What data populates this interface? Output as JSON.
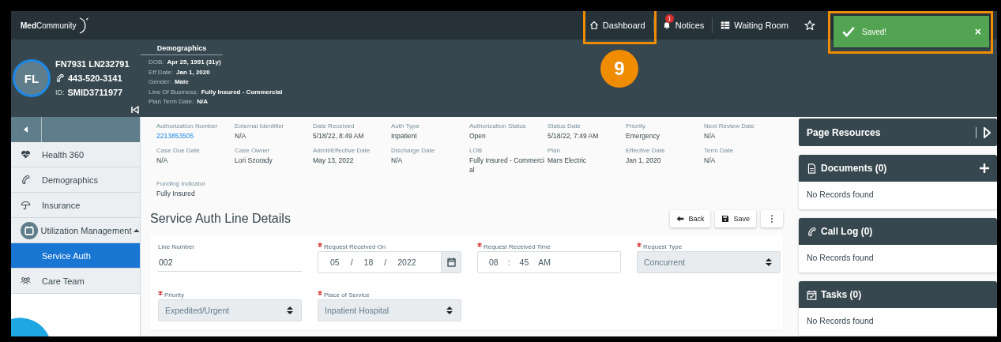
{
  "top_bar": {
    "logo": "**Med**Community",
    "nav": [
      {
        "kind": "dashboard",
        "label": "Dashboard"
      },
      {
        "kind": "notices",
        "label": "Notices",
        "badge": "1"
      },
      {
        "kind": "waiting",
        "label": "Waiting Room"
      },
      {
        "kind": "favorite"
      }
    ]
  },
  "toast": {
    "message": "Saved!",
    "close": "×"
  },
  "annotation": {
    "step": "9"
  },
  "patient": {
    "initials": "FL",
    "name": "FN7931 LN232791",
    "phone": "443-520-3141",
    "id_label": "ID:",
    "id": "SMID3711977"
  },
  "demographics": {
    "title": "Demographics",
    "rows": [
      {
        "label": "DOB:",
        "value": "Apr 25, 1991 (31y)"
      },
      {
        "label": "Eff Date:",
        "value": "Jan 1, 2020"
      },
      {
        "label": "Gender:",
        "value": "Male"
      },
      {
        "label": "Line Of Business:",
        "value": "Fully Insured - Commercial"
      },
      {
        "label": "Plan Term Date:",
        "value": "N/A"
      }
    ]
  },
  "sidebar": {
    "items": [
      {
        "kind": "heart",
        "label": "Health 360",
        "selected": false
      },
      {
        "kind": "phone",
        "label": "Demographics",
        "selected": false
      },
      {
        "kind": "umbrella",
        "label": "Insurance",
        "selected": false
      },
      {
        "kind": "calendar",
        "label": "Utilization Management",
        "selected": false,
        "expanded": true,
        "children": [
          {
            "label": "Service Auth",
            "selected": true
          }
        ]
      },
      {
        "kind": "team",
        "label": "Care Team",
        "selected": false
      }
    ]
  },
  "auth_info": [
    {
      "label": "Authorization Number",
      "value": "2213853505",
      "link": true
    },
    {
      "label": "External Identifier",
      "value": "N/A"
    },
    {
      "label": "Date Received",
      "value": "5/18/22, 8:49 AM"
    },
    {
      "label": "Auth Type",
      "value": "Inpatient"
    },
    {
      "label": "Authorization Status",
      "value": "Open"
    },
    {
      "label": "Status Date",
      "value": "5/18/22, 7:49 AM"
    },
    {
      "label": "Priority",
      "value": "Emergency"
    },
    {
      "label": "Next Review Date",
      "value": "N/A"
    },
    {
      "label": "Case Due Date",
      "value": "N/A"
    },
    {
      "label": "Case Owner",
      "value": "Lori Szorady"
    },
    {
      "label": "Admit/Effective Date",
      "value": "May 13, 2022"
    },
    {
      "label": "Discharge Date",
      "value": "N/A"
    },
    {
      "label": "LOB",
      "value": "Fully Insured - Commercial"
    },
    {
      "label": "Plan",
      "value": "Mars Electric"
    },
    {
      "label": "Effective Date",
      "value": "Jan 1, 2020"
    },
    {
      "label": "Term Date",
      "value": "N/A"
    },
    {
      "label": "Funding Indicator",
      "value": "Fully Insured"
    }
  ],
  "section": {
    "title": "Service Auth Line Details",
    "buttons": [
      {
        "kind": "back",
        "label": "Back"
      },
      {
        "kind": "save",
        "label": "Save"
      },
      {
        "kind": "more"
      }
    ]
  },
  "form_fields": [
    {
      "kind": "text",
      "label": "Line Number",
      "required": false,
      "value": "002"
    },
    {
      "kind": "date",
      "label": "Request Received On",
      "required": true,
      "parts": [
        "05",
        "/",
        "18",
        "/",
        "2022"
      ]
    },
    {
      "kind": "time",
      "label": "Request Received Time",
      "required": true,
      "parts": [
        "08",
        ":",
        "45",
        "AM"
      ]
    },
    {
      "kind": "select",
      "label": "Request Type",
      "required": true,
      "value": "Concurrent"
    },
    {
      "kind": "select",
      "label": "Priority",
      "required": true,
      "value": "Expedited/Urgent"
    },
    {
      "kind": "select",
      "label": "Place of Service",
      "required": true,
      "value": "Inpatient Hospital"
    }
  ],
  "resources": {
    "title": "Page Resources",
    "cards": [
      {
        "kind": "documents",
        "title": "Documents (0)",
        "addable": true,
        "empty": "No Records found"
      },
      {
        "kind": "calls",
        "title": "Call Log (0)",
        "addable": false,
        "empty": "No Records found"
      },
      {
        "kind": "tasks",
        "title": "Tasks (0)",
        "addable": false,
        "empty": "No Records found"
      }
    ]
  }
}
